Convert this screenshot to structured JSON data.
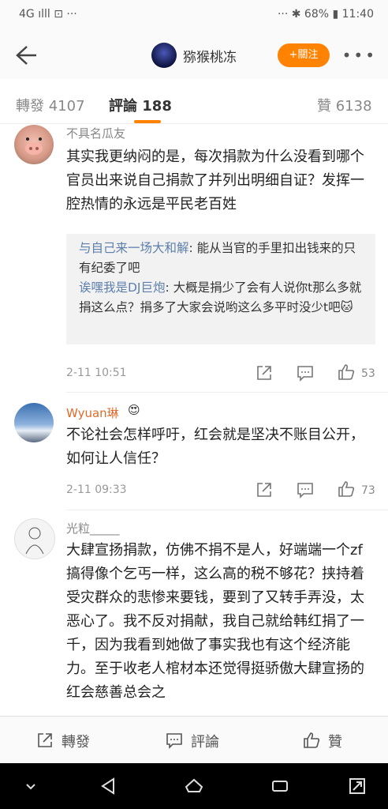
{
  "status_bar": {
    "left": "4G  ılll  ⊡  ···",
    "right": "··· ✱ 68% ▮ 11:40"
  },
  "header": {
    "title": "猕猴桃冻",
    "follow_label": "+關注"
  },
  "tabs": [
    {
      "label": "轉發 4107"
    },
    {
      "label": "評論 188"
    },
    {
      "label": "贊 6138"
    }
  ],
  "comments": [
    {
      "user": "不具名瓜友",
      "text": "其实我更纳闷的是，每次捐款为什么没看到哪个官员出来说自己捐款了并列出明细自证？发挥一腔热情的永远是平民老百姓",
      "replies": [
        {
          "name": "与自己来一场大和解",
          "text": ": 能从当官的手里扣出钱来的只有纪委了吧"
        },
        {
          "name": "诶嘿我是DJ巨炮",
          "text": ": 大概是捐少了会有人说你t那么多就捐这么点？捐多了大家会说哟这么多平时没少t吧🐱"
        }
      ],
      "time": "2-11 10:51",
      "likes": "53"
    },
    {
      "user": "Wyuan琳",
      "badge": "😍",
      "text": "不论社会怎样呼吁，红会就是坚决不账目公开，如何让人信任？",
      "time": "2-11 09:33",
      "likes": "73"
    },
    {
      "user": "光粒_____",
      "text": "大肆宣扬捐款，仿佛不捐不是人，好端端一个zf搞得像个乞丐一样，这么高的税不够花？挟持着受灾群众的悲惨来要钱，要到了又转手弄没，太恶心了。我不反对捐献，我自己就给韩红捐了一千，因为我看到她做了事实我也有这个经济能力。至于收老人棺材本还觉得挺骄傲大肆宣扬的红会慈善总会之"
    }
  ],
  "bottom_bar": {
    "repost": "轉發",
    "comment": "評論",
    "like": "贊"
  },
  "colors": {
    "accent": "#ff8200",
    "reply_name": "#5d7fab"
  }
}
